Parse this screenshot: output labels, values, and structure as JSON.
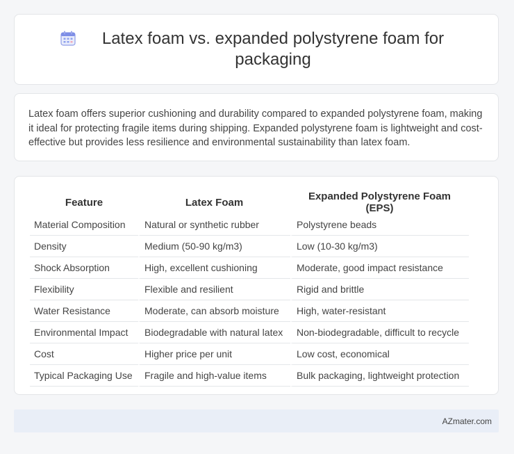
{
  "header": {
    "title": "Latex foam vs. expanded polystyrene foam for packaging",
    "icon": "calendar-icon"
  },
  "summary": {
    "text": "Latex foam offers superior cushioning and durability compared to expanded polystyrene foam, making it ideal for protecting fragile items during shipping. Expanded polystyrene foam is lightweight and cost-effective but provides less resilience and environmental sustainability than latex foam."
  },
  "table": {
    "headers": [
      "Feature",
      "Latex Foam",
      "Expanded Polystyrene Foam (EPS)"
    ],
    "rows": [
      [
        "Material Composition",
        "Natural or synthetic rubber",
        "Polystyrene beads"
      ],
      [
        "Density",
        "Medium (50-90 kg/m3)",
        "Low (10-30 kg/m3)"
      ],
      [
        "Shock Absorption",
        "High, excellent cushioning",
        "Moderate, good impact resistance"
      ],
      [
        "Flexibility",
        "Flexible and resilient",
        "Rigid and brittle"
      ],
      [
        "Water Resistance",
        "Moderate, can absorb moisture",
        "High, water-resistant"
      ],
      [
        "Environmental Impact",
        "Biodegradable with natural latex",
        "Non-biodegradable, difficult to recycle"
      ],
      [
        "Cost",
        "Higher price per unit",
        "Low cost, economical"
      ],
      [
        "Typical Packaging Use",
        "Fragile and high-value items",
        "Bulk packaging, lightweight protection"
      ]
    ]
  },
  "footer": {
    "brand": "AZmater.com"
  },
  "colors": {
    "page_background": "#f5f6f8",
    "card_background": "#ffffff",
    "footer_background": "#e9eef7",
    "icon_accent": "#6f7fe0"
  }
}
